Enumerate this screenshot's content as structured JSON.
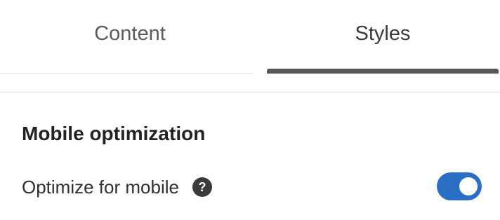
{
  "tabs": [
    {
      "label": "Content",
      "selected": false
    },
    {
      "label": "Styles",
      "selected": true
    }
  ],
  "section": {
    "title": "Mobile optimization",
    "settings": [
      {
        "label": "Optimize for mobile",
        "help_icon": "question-mark-icon",
        "help_glyph": "?",
        "toggle_on": true
      }
    ]
  },
  "colors": {
    "toggle_on": "#2a6fc4",
    "tab_indicator": "#585858",
    "help_icon_bg": "#3b3b3b"
  }
}
